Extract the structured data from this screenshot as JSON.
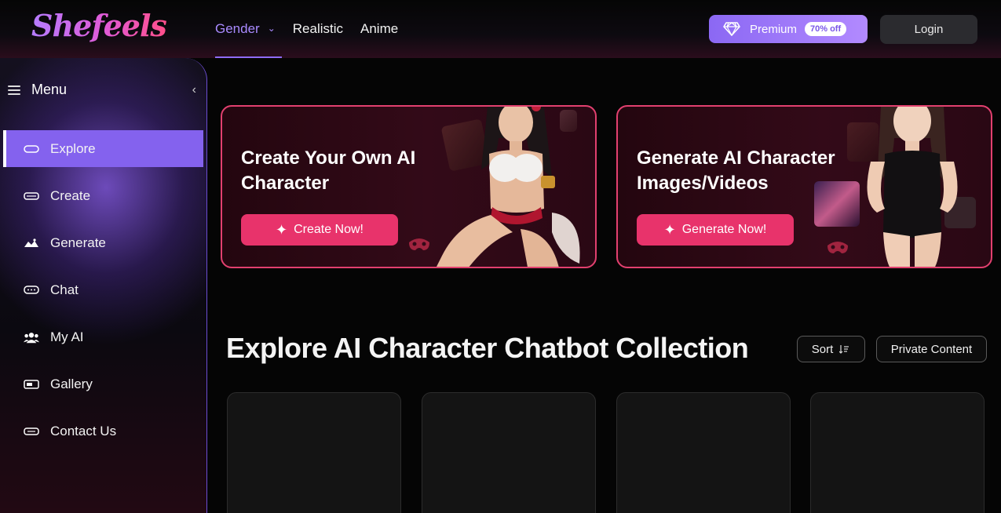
{
  "header": {
    "logo_text": "Shefeels",
    "nav": [
      {
        "label": "Gender",
        "active": true,
        "has_dropdown": true
      },
      {
        "label": "Realistic",
        "active": false
      },
      {
        "label": "Anime",
        "active": false
      }
    ],
    "premium_label": "Premium",
    "premium_badge": "70% off",
    "login_label": "Login"
  },
  "sidebar": {
    "title": "Menu",
    "items": [
      {
        "label": "Explore",
        "icon": "explore-icon",
        "active": true
      },
      {
        "label": "Create",
        "icon": "create-icon",
        "active": false
      },
      {
        "label": "Generate",
        "icon": "generate-icon",
        "active": false
      },
      {
        "label": "Chat",
        "icon": "chat-icon",
        "active": false
      },
      {
        "label": "My AI",
        "icon": "my-ai-icon",
        "active": false
      },
      {
        "label": "Gallery",
        "icon": "gallery-icon",
        "active": false
      },
      {
        "label": "Contact Us",
        "icon": "contact-icon",
        "active": false
      }
    ]
  },
  "banners": [
    {
      "title_line1": "Create Your Own AI",
      "title_line2": "Character",
      "button": "Create Now!"
    },
    {
      "title_line1": "Generate AI Character",
      "title_line2": "Images/Videos",
      "button": "Generate Now!"
    }
  ],
  "collection": {
    "title": "Explore AI Character Chatbot Collection",
    "sort_label": "Sort",
    "private_label": "Private Content"
  },
  "colors": {
    "accent_purple": "#8462ee",
    "accent_pink": "#e8336b",
    "banner_border": "#e2406f"
  }
}
